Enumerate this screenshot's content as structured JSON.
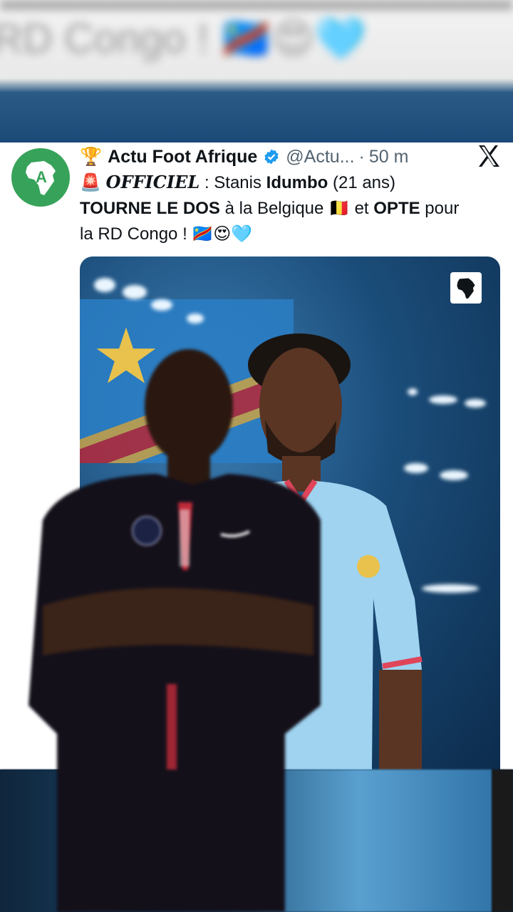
{
  "background": {
    "blurred_text": "RD Congo ! 🇨🇩😍🩵"
  },
  "tweet": {
    "trophy_emoji": "🏆",
    "account_name": "Actu Foot Afrique",
    "handle": "@Actu...",
    "separator": "·",
    "time": "50 m",
    "line1_emoji": "🚨",
    "official_word": "OFFICIEL",
    "line1_rest_a": " : Stanis ",
    "line1_bold": "Idumbo",
    "line1_rest_b": " (21 ans)",
    "line2_bold_a": "TOURNE LE DOS",
    "line2_text_a": " à la Belgique 🇧🇪 et ",
    "line2_bold_b": "OPTE",
    "line2_text_b": " pour",
    "line3_text": "la RD Congo ! 🇨🇩😍🩵"
  },
  "icons": {
    "avatar": "africa-map-logo",
    "verified": "verified-badge-icon",
    "platform": "x-logo-icon",
    "media_badge": "africa-logo-icon"
  },
  "colors": {
    "avatar_green": "#37a35a",
    "verified_blue": "#1d9bf0",
    "jersey_blue": "#9fd3f0",
    "psg_navy": "#0f1a33"
  }
}
